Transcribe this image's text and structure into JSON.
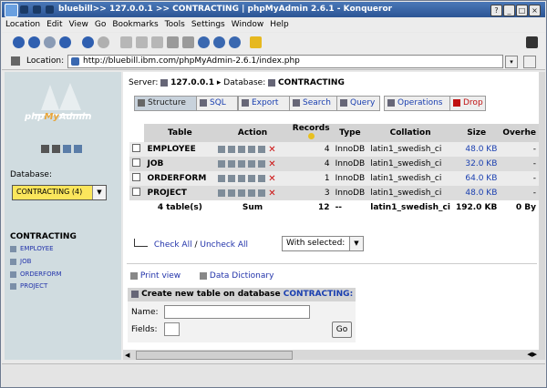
{
  "window": {
    "title": "bluebill>> 127.0.0.1 >> CONTRACTING | phpMyAdmin 2.6.1 - Konqueror"
  },
  "menu": [
    "Location",
    "Edit",
    "View",
    "Go",
    "Bookmarks",
    "Tools",
    "Settings",
    "Window",
    "Help"
  ],
  "location": {
    "label": "Location:",
    "url": "http://bluebill.ibm.com/phpMyAdmin-2.6.1/index.php"
  },
  "sidebar": {
    "logo": {
      "php": "php",
      "my": "My",
      "admin": "Admin"
    },
    "database_label": "Database:",
    "database_selected": "CONTRACTING (4)",
    "db_heading": "CONTRACTING",
    "items": [
      {
        "label": "EMPLOYEE"
      },
      {
        "label": "JOB"
      },
      {
        "label": "ORDERFORM"
      },
      {
        "label": "PROJECT"
      }
    ]
  },
  "breadcrumb": {
    "server_label": "Server:",
    "server": "127.0.0.1",
    "database_label": "Database:",
    "database": "CONTRACTING"
  },
  "tabs": [
    {
      "label": "Structure"
    },
    {
      "label": "SQL"
    },
    {
      "label": "Export"
    },
    {
      "label": "Search"
    },
    {
      "label": "Query"
    },
    {
      "label": "Operations"
    },
    {
      "label": "Drop"
    }
  ],
  "table": {
    "headers": {
      "table": "Table",
      "action": "Action",
      "records": "Records",
      "type": "Type",
      "collation": "Collation",
      "size": "Size",
      "overhead": "Overhe"
    },
    "rows": [
      {
        "name": "EMPLOYEE",
        "records": "4",
        "type": "InnoDB",
        "collation": "latin1_swedish_ci",
        "size": "48.0 KB",
        "overhead": "-"
      },
      {
        "name": "JOB",
        "records": "4",
        "type": "InnoDB",
        "collation": "latin1_swedish_ci",
        "size": "32.0 KB",
        "overhead": "-"
      },
      {
        "name": "ORDERFORM",
        "records": "1",
        "type": "InnoDB",
        "collation": "latin1_swedish_ci",
        "size": "64.0 KB",
        "overhead": "-"
      },
      {
        "name": "PROJECT",
        "records": "3",
        "type": "InnoDB",
        "collation": "latin1_swedish_ci",
        "size": "48.0 KB",
        "overhead": "-"
      }
    ],
    "footer": {
      "tables": "4 table(s)",
      "sum": "Sum",
      "records": "12",
      "type": "--",
      "collation": "latin1_swedish_ci",
      "size": "192.0 KB",
      "overhead": "0 By"
    }
  },
  "below_table": {
    "check_all": "Check All",
    "separator": " / ",
    "uncheck_all": "Uncheck All",
    "with_selected": "With selected:"
  },
  "links": {
    "print_view": "Print view",
    "data_dictionary": "Data Dictionary"
  },
  "create_table": {
    "heading": "Create new table on database",
    "db": "CONTRACTING:",
    "name_label": "Name:",
    "fields_label": "Fields:",
    "go": "Go"
  }
}
